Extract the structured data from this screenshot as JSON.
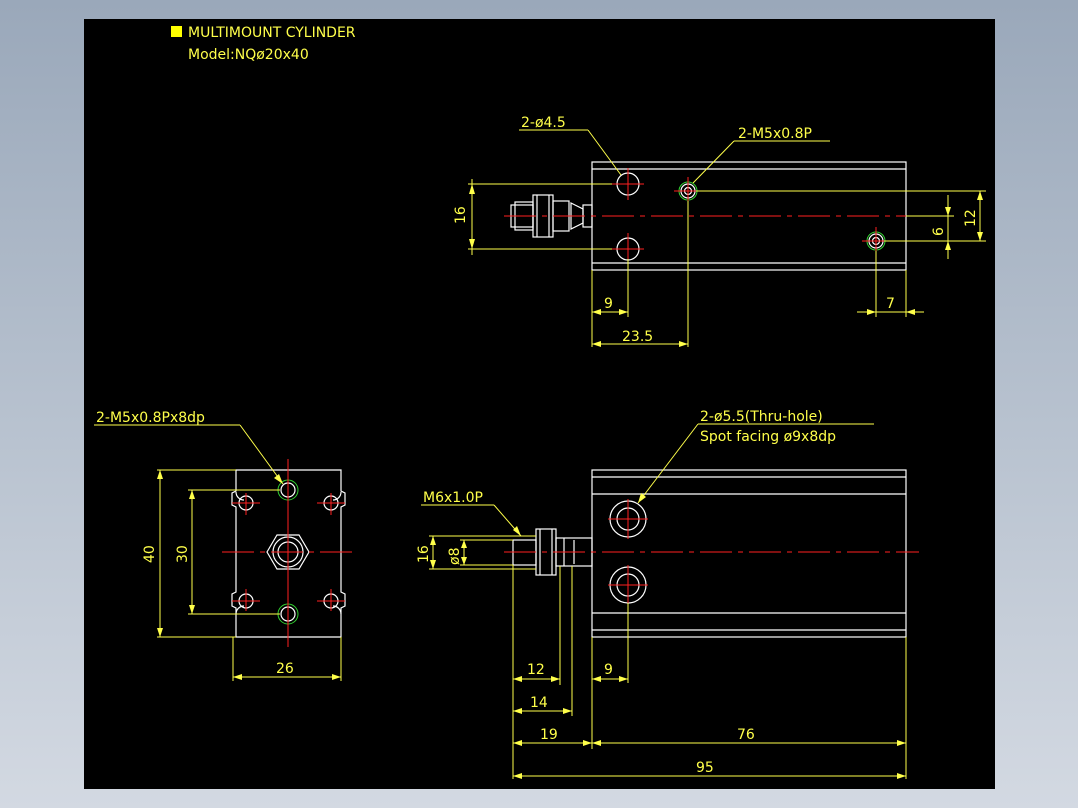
{
  "title_block": {
    "title": "MULTIMOUNT CYLINDER",
    "model": "Model:NQø20x40",
    "marker_color": "#ffff00"
  },
  "top_view": {
    "callout_holes": "2-ø4.5",
    "callout_taps": "2-M5x0.8P",
    "dim_height": "16",
    "dim_left_9": "9",
    "dim_23_5": "23.5",
    "dim_right_7": "7",
    "dim_6": "6",
    "dim_12": "12"
  },
  "end_view": {
    "callout": "2-M5x0.8Px8dp",
    "dim_40": "40",
    "dim_30": "30",
    "dim_26": "26"
  },
  "front_view": {
    "callout_line1": "2-ø5.5(Thru-hole)",
    "callout_line2": "Spot facing ø9x8dp",
    "thread": "M6x1.0P",
    "dim_16": "16",
    "dim_8": "ø8",
    "dim_12": "12",
    "dim_14": "14",
    "dim_19": "19",
    "dim_9": "9",
    "dim_76": "76",
    "dim_95": "95"
  },
  "colors": {
    "background": "#000000",
    "dimension": "#ffff4a",
    "object": "#ffffff",
    "centerline": "#ff2020",
    "hole_ring": "#30d030"
  }
}
